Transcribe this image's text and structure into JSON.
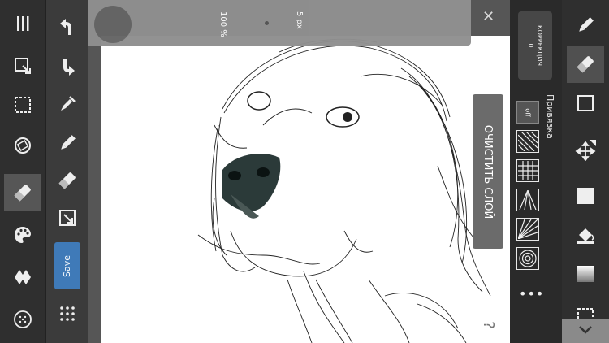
{
  "brush": {
    "opacity_label": "100 %",
    "size_label": "5 px"
  },
  "toolbar_left": {
    "save_label": "Save"
  },
  "canvas": {
    "clear_layer_label": "ОЧИСТИТЬ СЛОЙ"
  },
  "guides": {
    "correction_title": "КОРРЕКЦИЯ",
    "correction_value": "0",
    "snap_title": "Привязка",
    "off_label": "off"
  },
  "colors": {
    "accent": "#3f7ab8",
    "canvas": "#ffffff",
    "toolbar": "#2f2f2f"
  }
}
